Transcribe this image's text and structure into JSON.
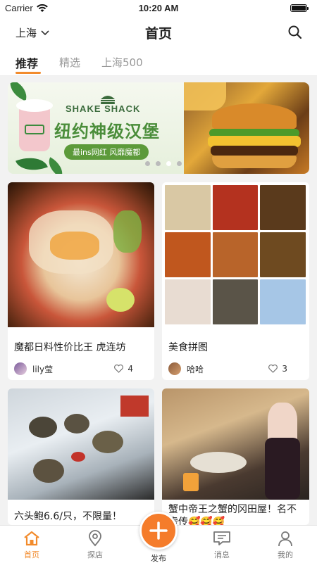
{
  "status_bar": {
    "carrier": "Carrier",
    "time": "10:20 AM"
  },
  "header": {
    "city": "上海",
    "title": "首页"
  },
  "tabs": [
    {
      "label": "推荐",
      "active": true
    },
    {
      "label": "精选",
      "active": false
    },
    {
      "label": "上海500",
      "active": false
    }
  ],
  "banner": {
    "brand": "SHAKE SHACK",
    "headline": "纽约神级汉堡",
    "tagline": "最ins网红 风靡魔都",
    "page_count": 4,
    "current_page": 3
  },
  "posts": [
    {
      "title": "魔都日料性价比王 虎连坊",
      "author": "lily莹",
      "likes": "4"
    },
    {
      "title": "美食拼图",
      "author": "哈哈",
      "likes": "3"
    },
    {
      "title": "六头鲍6.6/只，不限量！",
      "author": "",
      "likes": ""
    },
    {
      "title_line1": "蟹中帝王之蟹的冈田屋！名不",
      "title_line2": "虚传🥰🥰🥰",
      "author": "",
      "likes": ""
    }
  ],
  "tabbar": [
    {
      "label": "首页",
      "icon": "home-icon",
      "active": true
    },
    {
      "label": "探店",
      "icon": "location-pin-icon",
      "active": false
    },
    {
      "label": "发布",
      "icon": "plus-icon",
      "active": false
    },
    {
      "label": "消息",
      "icon": "message-icon",
      "active": false
    },
    {
      "label": "我的",
      "icon": "user-icon",
      "active": false
    }
  ],
  "colors": {
    "accent": "#f28b2c",
    "publish": "#f57c2b",
    "brand_green": "#4a8d3a"
  }
}
